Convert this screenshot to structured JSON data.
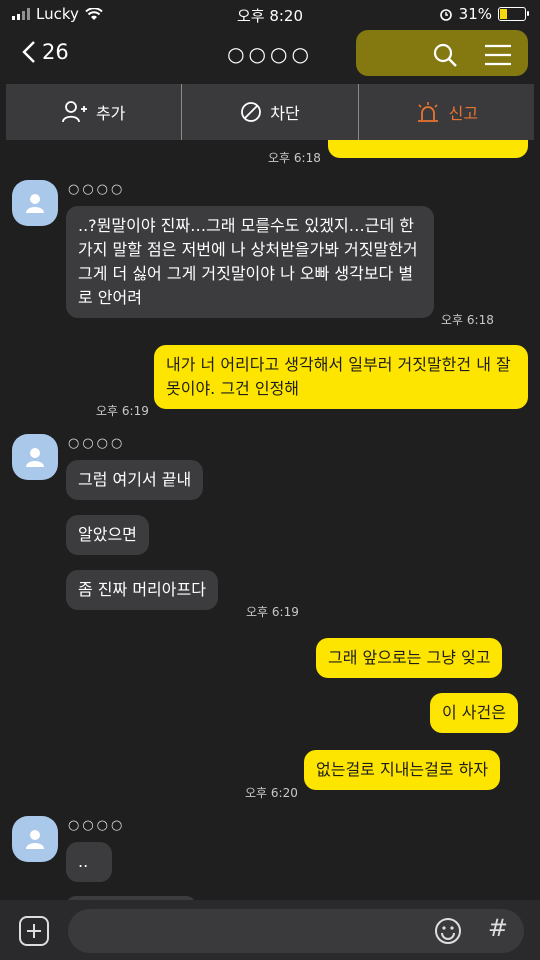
{
  "status": {
    "carrier": "Lucky",
    "time": "오후 8:20",
    "battery": "31%",
    "battery_level": 0.31
  },
  "nav": {
    "back_count": "26",
    "title": "○○○○"
  },
  "actionbar": {
    "add": "추가",
    "block": "차단",
    "report": "신고"
  },
  "messages": {
    "top_ts": "오후 6:18",
    "sender_name": "○○○○",
    "m1_text": "..?뭔말이야 진짜…그래 모를수도 있겠지…근데 한가지 말할 점은 저번에 나 상처받을가봐 거짓말한거 그게 더 싫어 그게 거짓말이야 나 오빠 생각보다 별로 안어려",
    "m1_ts": "오후 6:18",
    "m2_text": "내가 너 어리다고 생각해서 일부러 거짓말한건 내 잘못이야. 그건 인정해",
    "m2_ts": "오후 6:19",
    "m3_text": "그럼 여기서 끝내",
    "m4_text": "알았으면",
    "m5_text": "좀 진짜 머리아프다",
    "m5_ts": "오후 6:19",
    "m6_text": "그래 앞으로는 그냥 잊고",
    "m7_text": "이 사건은",
    "m8_text": "없는걸로 지내는걸로 하자",
    "m8_ts": "오후 6:20",
    "m9_text": ".."
  },
  "colors": {
    "sent_bubble": "#fee500",
    "recv_bubble": "#3c3c3e",
    "report_accent": "#e8742f"
  }
}
